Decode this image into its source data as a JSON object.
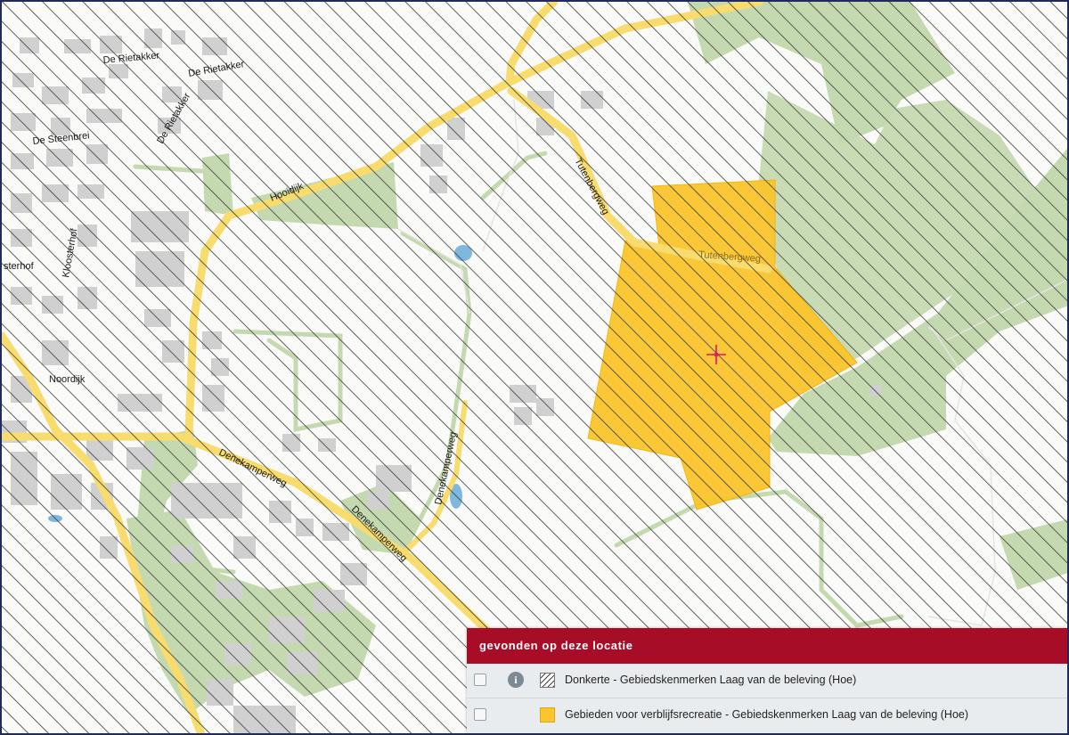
{
  "map": {
    "streets": [
      {
        "id": "de-rietakker-1",
        "label": "De Rietakker"
      },
      {
        "id": "de-rietakker-2",
        "label": "De Rietakker"
      },
      {
        "id": "de-rietakker-3",
        "label": "De Rietakker"
      },
      {
        "id": "de-steenbrei",
        "label": "De Steenbrei"
      },
      {
        "id": "hooidijk",
        "label": "Hooidijk"
      },
      {
        "id": "kloosterhof",
        "label": "Kloosterhof"
      },
      {
        "id": "sterhof",
        "label": "sterhof"
      },
      {
        "id": "noordijk",
        "label": "Noordijk"
      },
      {
        "id": "denekamperweg-1",
        "label": "Denekamperweg"
      },
      {
        "id": "denekamperweg-2",
        "label": "Denekamperweg"
      },
      {
        "id": "denekamperweg-3",
        "label": "Denekamperweg"
      },
      {
        "id": "tutenbergweg-1",
        "label": "Tutenbergweg"
      },
      {
        "id": "tutenbergweg-2",
        "label": "Tutenbergweg"
      }
    ],
    "colors": {
      "hatch": "#3a3a3a",
      "road": "#f8dc6e",
      "forest": "#c5d9b0",
      "building": "#d0d0d0",
      "water": "#7fb8de",
      "recreation_area": "#fbc52d",
      "location_marker": "#e0156b"
    },
    "marker_icon": "crosshair-icon"
  },
  "panel": {
    "title": "gevonden op deze locatie",
    "layers": [
      {
        "label": "Donkerte - Gebiedskenmerken Laag van de beleving (Hoe)",
        "has_info": true,
        "info_glyph": "i",
        "swatch": "hatch",
        "checked": false
      },
      {
        "label": "Gebieden voor verblijfsrecreatie - Gebiedskenmerken Laag van de beleving (Hoe)",
        "has_info": false,
        "swatch": "yellow",
        "checked": false
      }
    ]
  }
}
